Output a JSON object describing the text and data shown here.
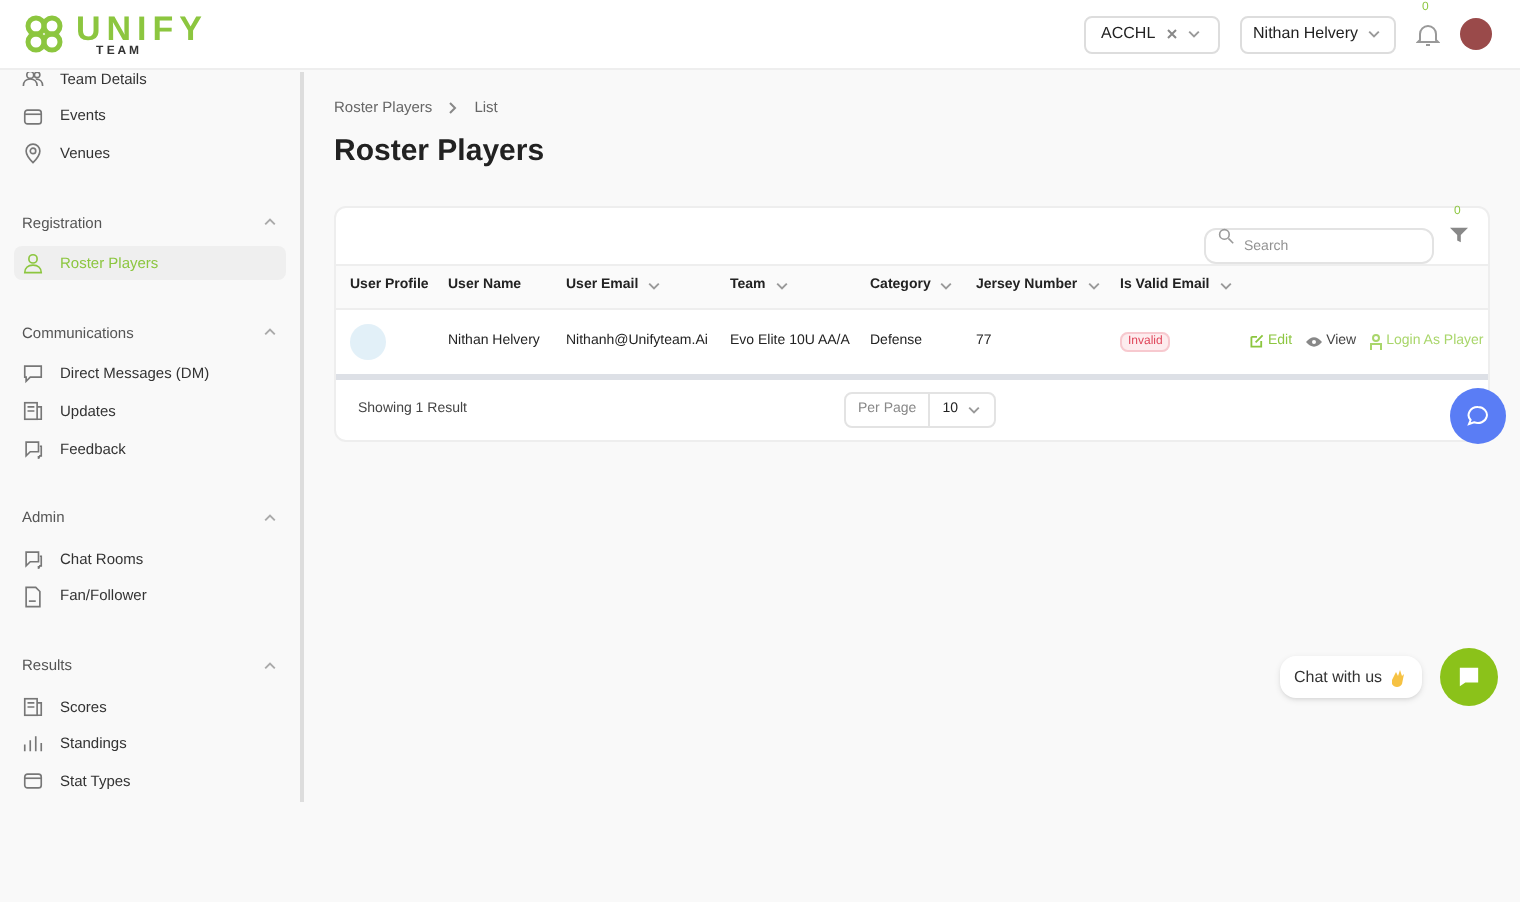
{
  "logo": {
    "word": "UNIFY",
    "subword": "T E A M"
  },
  "header": {
    "league_select": {
      "value": "ACCHL"
    },
    "user_select": {
      "value": "Nithan Helvery"
    },
    "notifications": {
      "count": "0"
    }
  },
  "sidebar": {
    "sections": [
      {
        "items": [
          {
            "label": "Team Details",
            "selected": false
          },
          {
            "label": "Events",
            "selected": false
          },
          {
            "label": "Venues",
            "selected": false
          }
        ]
      },
      {
        "title": "Registration",
        "expanded": true,
        "items": [
          {
            "label": "Roster Players",
            "selected": true
          }
        ]
      },
      {
        "title": "Communications",
        "expanded": true,
        "items": [
          {
            "label": "Direct Messages (DM)",
            "selected": false
          },
          {
            "label": "Updates",
            "selected": false
          },
          {
            "label": "Feedback",
            "selected": false
          }
        ]
      },
      {
        "title": "Admin",
        "expanded": true,
        "items": [
          {
            "label": "Chat Rooms",
            "selected": false
          },
          {
            "label": "Fan/Follower",
            "selected": false
          }
        ]
      },
      {
        "title": "Results",
        "expanded": true,
        "items": [
          {
            "label": "Scores",
            "selected": false
          },
          {
            "label": "Standings",
            "selected": false
          },
          {
            "label": "Stat Types",
            "selected": false
          }
        ]
      }
    ]
  },
  "breadcrumb": [
    "Roster Players",
    "List"
  ],
  "page_title": "Roster Players",
  "search": {
    "placeholder": "Search"
  },
  "filter_count": "0",
  "table": {
    "columns": [
      {
        "label": "User Profile",
        "sortable": false
      },
      {
        "label": "User Name",
        "sortable": false
      },
      {
        "label": "User Email",
        "sortable": true
      },
      {
        "label": "Team",
        "sortable": true
      },
      {
        "label": "Category",
        "sortable": true
      },
      {
        "label": "Jersey Number",
        "sortable": true
      },
      {
        "label": "Is Valid Email",
        "sortable": true
      }
    ],
    "rows": [
      {
        "user_name": "Nithan Helvery",
        "user_email": "Nithanh@Unifyteam.Ai",
        "team": "Evo Elite 10U AA/A",
        "category": "Defense",
        "jersey_number": "77",
        "is_valid_email": "Invalid",
        "actions": [
          "Edit",
          "View",
          "Login As Player"
        ]
      }
    ]
  },
  "footer": {
    "summary": "Showing 1 Result",
    "per_page_label": "Per Page",
    "per_page_value": "10"
  },
  "chat_widget": {
    "label": "Chat with us"
  }
}
